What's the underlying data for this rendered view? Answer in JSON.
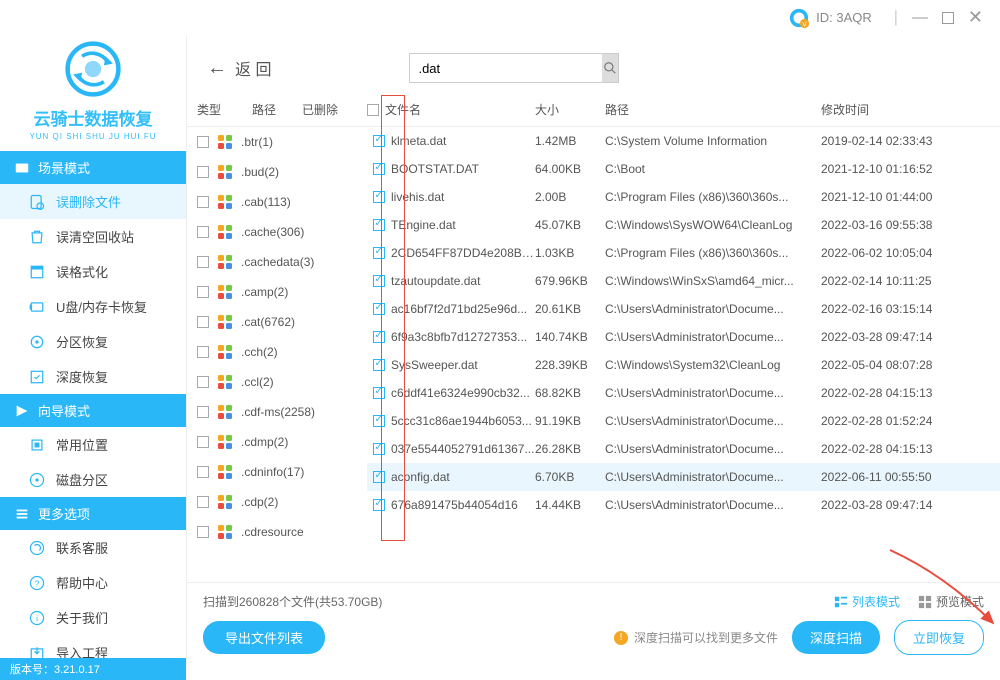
{
  "titlebar": {
    "id_label": "ID: 3AQR"
  },
  "logo": {
    "title": "云骑士数据恢复",
    "sub": "YUN QI SHI SHU JU HUI FU"
  },
  "sidebar": {
    "sections": [
      {
        "header": "场景模式",
        "items": [
          {
            "label": "误删除文件",
            "active": true,
            "icon": "file-recover"
          },
          {
            "label": "误清空回收站",
            "icon": "recycle"
          },
          {
            "label": "误格式化",
            "icon": "format"
          },
          {
            "label": "U盘/内存卡恢复",
            "icon": "usb"
          },
          {
            "label": "分区恢复",
            "icon": "partition"
          },
          {
            "label": "深度恢复",
            "icon": "deep"
          }
        ]
      },
      {
        "header": "向导模式",
        "items": [
          {
            "label": "常用位置",
            "icon": "location"
          },
          {
            "label": "磁盘分区",
            "icon": "disk"
          }
        ]
      },
      {
        "header": "更多选项",
        "items": [
          {
            "label": "联系客服",
            "icon": "contact"
          },
          {
            "label": "帮助中心",
            "icon": "help"
          },
          {
            "label": "关于我们",
            "icon": "about"
          },
          {
            "label": "导入工程",
            "icon": "import"
          }
        ]
      }
    ]
  },
  "back_label": "返  回",
  "search_value": ".dat",
  "type_head": {
    "type": "类型",
    "path": "路径",
    "deleted": "已删除"
  },
  "file_head": {
    "name": "文件名",
    "size": "大小",
    "path": "路径",
    "time": "修改时间"
  },
  "types": [
    {
      "label": ".btr(1)"
    },
    {
      "label": ".bud(2)"
    },
    {
      "label": ".cab(113)"
    },
    {
      "label": ".cache(306)"
    },
    {
      "label": ".cachedata(3)"
    },
    {
      "label": ".camp(2)"
    },
    {
      "label": ".cat(6762)"
    },
    {
      "label": ".cch(2)"
    },
    {
      "label": ".ccl(2)"
    },
    {
      "label": ".cdf-ms(2258)"
    },
    {
      "label": ".cdmp(2)"
    },
    {
      "label": ".cdninfo(17)"
    },
    {
      "label": ".cdp(2)"
    },
    {
      "label": ".cdresource"
    }
  ],
  "files": [
    {
      "name": "klmeta.dat",
      "size": "1.42MB",
      "path": "C:\\System Volume Information",
      "time": "2019-02-14 02:33:43"
    },
    {
      "name": "BOOTSTAT.DAT",
      "size": "64.00KB",
      "path": "C:\\Boot",
      "time": "2021-12-10 01:16:52"
    },
    {
      "name": "livehis.dat",
      "size": "2.00B",
      "path": "C:\\Program Files (x86)\\360\\360s...",
      "time": "2021-12-10 01:44:00"
    },
    {
      "name": "TEngine.dat",
      "size": "45.07KB",
      "path": "C:\\Windows\\SysWOW64\\CleanLog",
      "time": "2022-03-16 09:55:38"
    },
    {
      "name": "2CD654FF87DD4e208BA...",
      "size": "1.03KB",
      "path": "C:\\Program Files (x86)\\360\\360s...",
      "time": "2022-06-02 10:05:04"
    },
    {
      "name": "tzautoupdate.dat",
      "size": "679.96KB",
      "path": "C:\\Windows\\WinSxS\\amd64_micr...",
      "time": "2022-02-14 10:11:25"
    },
    {
      "name": "ac16bf7f2d71bd25e96d...",
      "size": "20.61KB",
      "path": "C:\\Users\\Administrator\\Docume...",
      "time": "2022-02-16 03:15:14"
    },
    {
      "name": "6f9a3c8bfb7d12727353...",
      "size": "140.74KB",
      "path": "C:\\Users\\Administrator\\Docume...",
      "time": "2022-03-28 09:47:14"
    },
    {
      "name": "SysSweeper.dat",
      "size": "228.39KB",
      "path": "C:\\Windows\\System32\\CleanLog",
      "time": "2022-05-04 08:07:28"
    },
    {
      "name": "c6ddf41e6324e990cb32...",
      "size": "68.82KB",
      "path": "C:\\Users\\Administrator\\Docume...",
      "time": "2022-02-28 04:15:13"
    },
    {
      "name": "5ccc31c86ae1944b6053...",
      "size": "91.19KB",
      "path": "C:\\Users\\Administrator\\Docume...",
      "time": "2022-02-28 01:52:24"
    },
    {
      "name": "037e5544052791d61367...",
      "size": "26.28KB",
      "path": "C:\\Users\\Administrator\\Docume...",
      "time": "2022-02-28 04:15:13"
    },
    {
      "name": "aconfig.dat",
      "size": "6.70KB",
      "path": "C:\\Users\\Administrator\\Docume...",
      "time": "2022-06-11 00:55:50",
      "hover": true
    },
    {
      "name": "676a891475b44054d16",
      "size": "14.44KB",
      "path": "C:\\Users\\Administrator\\Docume...",
      "time": "2022-03-28 09:47:14"
    }
  ],
  "scan_status": "扫描到260828个文件(共53.70GB)",
  "mode_list": "列表模式",
  "mode_preview": "预览模式",
  "btn_export": "导出文件列表",
  "deep_hint": "深度扫描可以找到更多文件",
  "btn_deep": "深度扫描",
  "btn_recover": "立即恢复",
  "version": "版本号：3.21.0.17"
}
